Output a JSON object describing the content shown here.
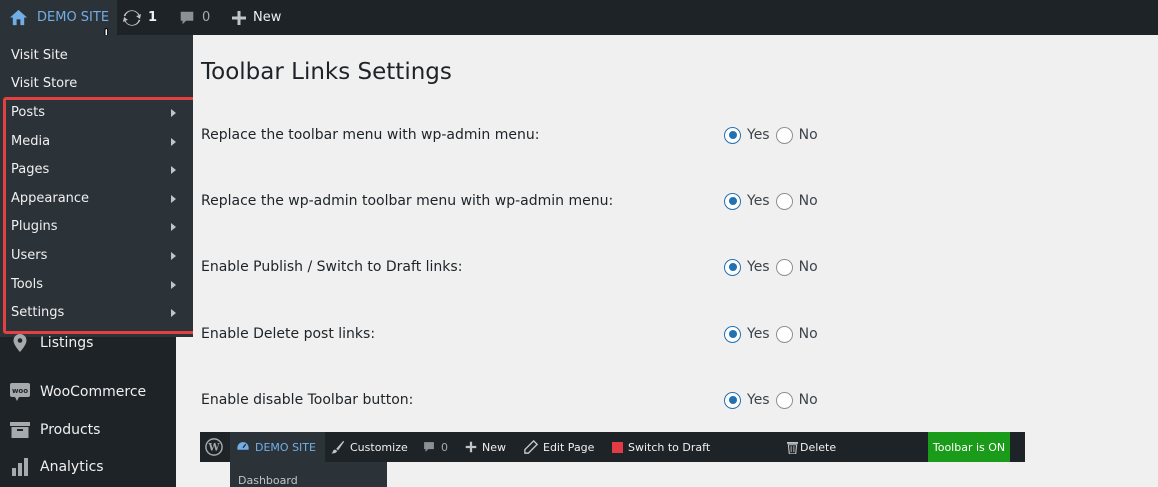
{
  "adminbar": {
    "site_label": "DEMO SITE",
    "updates_count": "1",
    "comments_count": "0",
    "new_label": "New"
  },
  "sidebar": {
    "dropdown_items": [
      {
        "label": "Visit Site",
        "has_submenu": false
      },
      {
        "label": "Visit Store",
        "has_submenu": false
      },
      {
        "label": "Posts",
        "has_submenu": true
      },
      {
        "label": "Media",
        "has_submenu": true
      },
      {
        "label": "Pages",
        "has_submenu": true
      },
      {
        "label": "Appearance",
        "has_submenu": true
      },
      {
        "label": "Plugins",
        "has_submenu": true
      },
      {
        "label": "Users",
        "has_submenu": true
      },
      {
        "label": "Tools",
        "has_submenu": true
      },
      {
        "label": "Settings",
        "has_submenu": true
      }
    ],
    "menu_items": [
      {
        "label": "Listings",
        "icon": "location-pin-icon"
      },
      {
        "label": "WooCommerce",
        "icon": "woocommerce-icon"
      },
      {
        "label": "Products",
        "icon": "archive-box-icon"
      },
      {
        "label": "Analytics",
        "icon": "bar-chart-icon"
      }
    ]
  },
  "main": {
    "title": "Toolbar Links Settings",
    "settings": [
      {
        "label": "Replace the toolbar menu with wp-admin menu:",
        "selected": "Yes"
      },
      {
        "label": "Replace the wp-admin toolbar menu with wp-admin menu:",
        "selected": "Yes"
      },
      {
        "label": "Enable Publish / Switch to Draft links:",
        "selected": "Yes"
      },
      {
        "label": "Enable Delete post links:",
        "selected": "Yes"
      },
      {
        "label": "Enable disable Toolbar button:",
        "selected": "Yes"
      }
    ],
    "yes_label": "Yes",
    "no_label": "No"
  },
  "preview_toolbar": {
    "site_label": "DEMO SITE",
    "customize_label": "Customize",
    "comments_count": "0",
    "new_label": "New",
    "edit_page_label": "Edit Page",
    "switch_draft_label": "Switch to Draft",
    "delete_label": "Delete",
    "toolbar_on_label": "Toolbar is ON",
    "submenu_first": "Dashboard"
  },
  "colors": {
    "admin_bg": "#1d2327",
    "accent": "#2271b1",
    "link_blue": "#72aee6",
    "highlight_red": "#e34141",
    "toolbar_on_green": "#1a9c1a",
    "draft_red": "#e23a47"
  }
}
